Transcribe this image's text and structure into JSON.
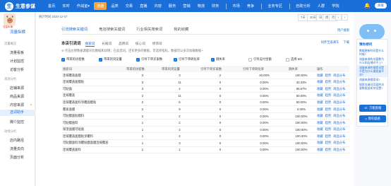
{
  "app": {
    "logo_glyph": "生",
    "name": "生意参谋"
  },
  "topnav": [
    {
      "label": "首页"
    },
    {
      "label": "实时"
    },
    {
      "label": "作战室▾"
    },
    {
      "label": "流量",
      "active": true
    },
    {
      "label": "品类"
    },
    {
      "label": "交易"
    },
    {
      "label": "直播"
    },
    {
      "label": "内容"
    },
    {
      "label": "服务"
    },
    {
      "label": "营销"
    },
    {
      "label": "物流"
    },
    {
      "label": "财务"
    },
    {
      "sep": true
    },
    {
      "label": "市场"
    },
    {
      "label": "竞争"
    },
    {
      "sep": true
    },
    {
      "label": "业务专区"
    },
    {
      "sep": true
    },
    {
      "label": "自助分析"
    },
    {
      "label": "人群"
    },
    {
      "label": "学院"
    }
  ],
  "user": {
    "name": "商家"
  },
  "sidebar": {
    "avatar_label": "流量纵横",
    "title": "流量纵横",
    "sections": [
      {
        "label": "流量概览",
        "items": [
          "流量看板",
          "计划监控",
          "访客分析"
        ]
      },
      {
        "label": "来源分析",
        "items": [
          "店铺来源",
          "商品来源",
          "内容来源",
          "选词助手",
          "媒介监控"
        ]
      },
      {
        "label": "动线分析",
        "items": [
          "店内路径",
          "流量去向",
          "页面分析"
        ]
      }
    ],
    "active_item": "选词助手"
  },
  "main": {
    "stat_time": "统计时间 2020-12-07",
    "date_buttons": [
      "7天",
      "30天",
      "日",
      "周",
      "月",
      "‹",
      "›"
    ],
    "tabs": [
      "引流搜索关键词",
      "竞店搜索关键词",
      "行业相关搜索词",
      "我的收藏"
    ],
    "active_tab": 0,
    "top_link": "用户搜索",
    "section_title": "本店引流词",
    "sub_tabs": [
      "搜索词",
      "长尾词",
      "品牌词",
      "核心词",
      "修饰词"
    ],
    "active_sub_tab": 0,
    "sub_links": [
      "同步至直通车",
      "下载"
    ],
    "tip": "⊘ 点击左侧数据源能对比数据和详情；在此选词，还有更多的数据，可选择指标，数据可以多次加载数据~",
    "checks": [
      {
        "label": "带来的访客数",
        "on": true
      },
      {
        "label": "带来的浏览量",
        "on": true
      },
      {
        "label": "引导下单买家数",
        "on": true
      },
      {
        "label": "引导下单转化率",
        "on": true
      },
      {
        "label": "跳失率",
        "on": true
      },
      {
        "label": "引导支付金额",
        "on": false
      },
      {
        "label": "选择 5/5",
        "on": false
      }
    ],
    "columns": [
      "搜索词",
      "带来的访客数",
      "带来的浏览量",
      "引导下单买家数",
      "引导下单转化率",
      "跳失率",
      "操作"
    ],
    "rows": [
      [
        "连域覆盖面膜",
        "3",
        "3",
        "2",
        "40.00%",
        "100.00%"
      ],
      [
        "连域覆盖面膜贴",
        "3",
        "11",
        "0",
        "0.00%",
        "33.33%"
      ],
      [
        "可贴面",
        "3",
        "4",
        "0",
        "0.00%",
        "66.67%"
      ],
      [
        "连域覆盖",
        "2",
        "11",
        "0",
        "0.00%",
        "50.00%"
      ],
      [
        "连域覆盖面料涂覆面膜贴",
        "2",
        "5",
        "0",
        "0.00%",
        "50.00%"
      ],
      [
        "覆盖面膜",
        "2",
        "9",
        "0",
        "0.00%",
        "0.00%"
      ],
      [
        "可贴膜面贴膜料",
        "2",
        "2",
        "0",
        "0.00%",
        "100.00%"
      ],
      [
        "可贴膜面料",
        "1",
        "2",
        "0",
        "0.00%",
        "100.00%"
      ],
      [
        "保湿面膜可贴面",
        "1",
        "2",
        "0",
        "0.00%",
        "100.00%"
      ],
      [
        "连域覆盖面膜贴涂覆料",
        "1",
        "2",
        "0",
        "0.00%",
        "100.00%"
      ],
      [
        "可贴膜面料涂覆贴膜面膜连域覆盖",
        "1",
        "3",
        "0",
        "0.00%",
        "100.00%"
      ],
      [
        "连域覆盖面料",
        "1",
        "1",
        "0",
        "0.00%",
        "100.00%"
      ]
    ],
    "ops": [
      "收藏",
      "趋势",
      "商品分布"
    ]
  },
  "panel": {
    "head": "猜你想问",
    "questions": [
      "数据更新时间是什么时候?",
      "流量来源的访客数为什么和店铺对不上?",
      "流量来源的搜索词是不是为什么搜索量不对?",
      "流量来源搜索词?",
      "搜索关键词页面的访客数据该如何设置?"
    ],
    "highlight_index": 2,
    "btn_manual": "万能客服",
    "btn_feedback": "我有疑惑"
  },
  "colors": {
    "brand": "#1a6ed8",
    "accent": "#f4a53a"
  }
}
